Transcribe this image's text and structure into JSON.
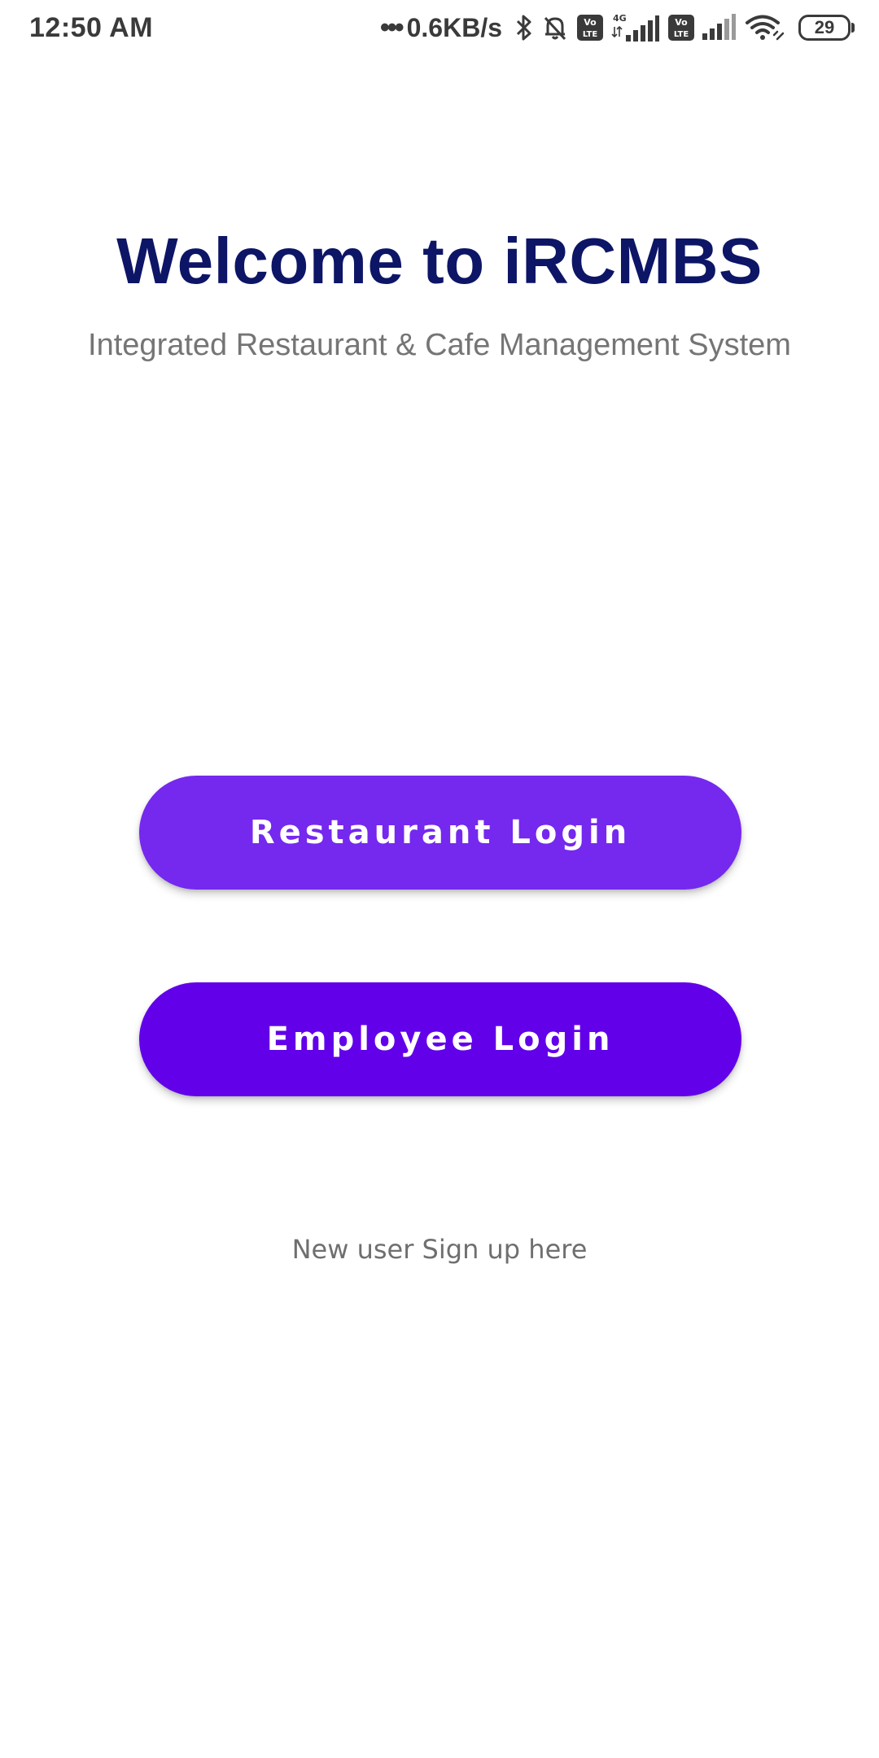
{
  "status_bar": {
    "time": "12:50 AM",
    "dots": "•••",
    "network_speed": "0.6KB/s",
    "icons": [
      "bluetooth-icon",
      "mute-bell-icon",
      "volte-icon",
      "4g-signal-icon",
      "volte-icon",
      "signal-icon",
      "wifi-icon"
    ],
    "network_type": "4G",
    "volte_label_top": "Vo",
    "volte_label_bottom": "LTE",
    "battery_level": "29"
  },
  "header": {
    "title": "Welcome to iRCMBS",
    "subtitle": "Integrated Restaurant & Cafe Management System"
  },
  "buttons": {
    "restaurant_login": "Restaurant Login",
    "employee_login": "Employee Login"
  },
  "signup": {
    "label": "New user Sign up here"
  },
  "colors": {
    "title": "#0d1566",
    "restaurant_button": "#7528ee",
    "employee_button": "#6200ea",
    "subtitle": "#757575"
  }
}
